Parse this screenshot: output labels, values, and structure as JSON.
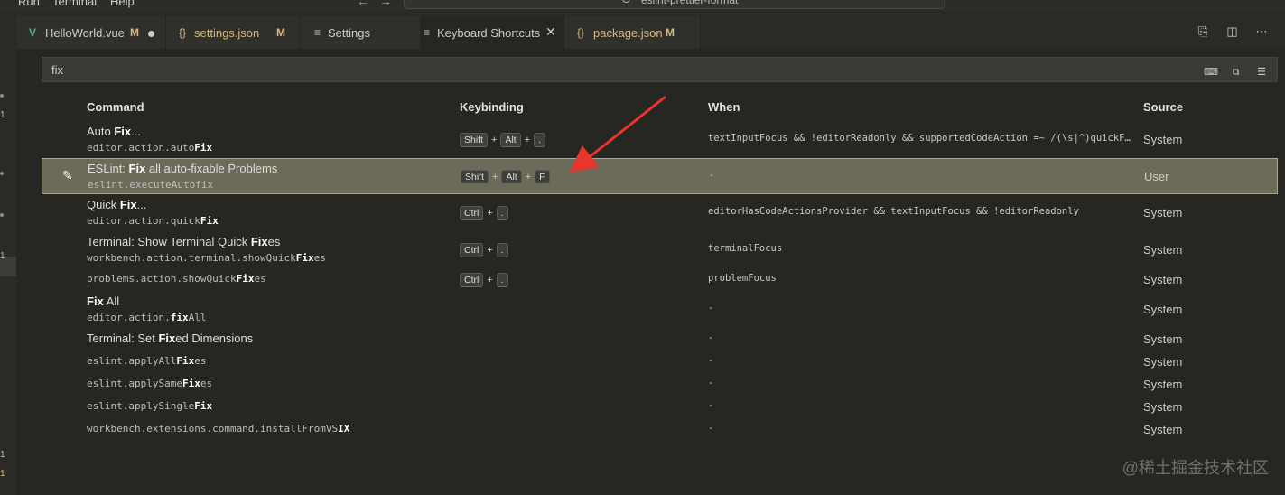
{
  "menu": {
    "run": "Run",
    "terminal": "Terminal",
    "help": "Help"
  },
  "command_center": {
    "label": "eslint-prettier-format",
    "icon": "search-icon"
  },
  "tabs": [
    {
      "icon": "V",
      "label": "HelloWorld.vue",
      "modified": "M",
      "color": "#41b883"
    },
    {
      "icon": "{}",
      "label": "settings.json",
      "modified": "M",
      "color": "#d7ba7d"
    },
    {
      "icon": "≡",
      "label": "Settings",
      "modified": ""
    },
    {
      "icon": "≡",
      "label": "Keyboard Shortcuts",
      "modified": "",
      "active": true
    },
    {
      "icon": "{}",
      "label": "package.json",
      "modified": "M",
      "color": "#d7ba7d"
    }
  ],
  "search": {
    "value": "fix"
  },
  "table": {
    "headers": {
      "command": "Command",
      "keybinding": "Keybinding",
      "when": "When",
      "source": "Source"
    },
    "rows": [
      {
        "title": [
          [
            "Auto ",
            false
          ],
          [
            "Fix",
            true
          ],
          [
            "...",
            false
          ]
        ],
        "id": [
          [
            "editor.action.auto",
            false
          ],
          [
            "Fix",
            true
          ]
        ],
        "keys": [
          "Shift",
          "Alt",
          "."
        ],
        "when": "textInputFocus && !editorReadonly && supportedCodeAction =~ /(\\s|^)quickFix\\b/",
        "source": "System"
      },
      {
        "title": [
          [
            "ESLint: ",
            false
          ],
          [
            "Fix",
            true
          ],
          [
            " all auto-fixable Problems",
            false
          ]
        ],
        "id": [
          [
            "eslint.executeAutofix",
            false
          ]
        ],
        "keys": [
          "Shift",
          "Alt",
          "F"
        ],
        "when": "-",
        "source": "User",
        "selected": true
      },
      {
        "title": [
          [
            "Quick ",
            false
          ],
          [
            "Fix",
            true
          ],
          [
            "...",
            false
          ]
        ],
        "id": [
          [
            "editor.action.quick",
            false
          ],
          [
            "Fix",
            true
          ]
        ],
        "keys": [
          "Ctrl",
          "."
        ],
        "when": "editorHasCodeActionsProvider && textInputFocus && !editorReadonly",
        "source": "System"
      },
      {
        "title": [
          [
            "Terminal: Show Terminal Quick ",
            false
          ],
          [
            "Fix",
            true
          ],
          [
            "es",
            false
          ]
        ],
        "id": [
          [
            "workbench.action.terminal.showQuick",
            false
          ],
          [
            "Fix",
            true
          ],
          [
            "es",
            false
          ]
        ],
        "keys": [
          "Ctrl",
          "."
        ],
        "when": "terminalFocus",
        "source": "System"
      },
      {
        "title": [],
        "id": [
          [
            "problems.action.showQuick",
            false
          ],
          [
            "Fix",
            true
          ],
          [
            "es",
            false
          ]
        ],
        "keys": [
          "Ctrl",
          "."
        ],
        "when": "problemFocus",
        "source": "System"
      },
      {
        "title": [
          [
            "Fix",
            true
          ],
          [
            " All",
            false
          ]
        ],
        "id": [
          [
            "editor.action.",
            false
          ],
          [
            "fix",
            true
          ],
          [
            "All",
            false
          ]
        ],
        "keys": [],
        "when": "-",
        "source": "System"
      },
      {
        "title": [
          [
            "Terminal: Set ",
            false
          ],
          [
            "Fix",
            true
          ],
          [
            "ed Dimensions",
            false
          ]
        ],
        "id": [],
        "keys": [],
        "when": "-",
        "source": "System"
      },
      {
        "title": [],
        "id": [
          [
            "eslint.applyAll",
            false
          ],
          [
            "Fix",
            true
          ],
          [
            "es",
            false
          ]
        ],
        "keys": [],
        "when": "-",
        "source": "System"
      },
      {
        "title": [],
        "id": [
          [
            "eslint.applySame",
            false
          ],
          [
            "Fix",
            true
          ],
          [
            "es",
            false
          ]
        ],
        "keys": [],
        "when": "-",
        "source": "System"
      },
      {
        "title": [],
        "id": [
          [
            "eslint.applySingle",
            false
          ],
          [
            "Fix",
            true
          ]
        ],
        "keys": [],
        "when": "-",
        "source": "System"
      },
      {
        "title": [],
        "id": [
          [
            "workbench.extensions.command.install",
            false
          ],
          [
            "Fr",
            false
          ],
          [
            "omVS",
            false
          ],
          [
            "IX",
            true
          ]
        ],
        "keys": [],
        "when": "-",
        "source": "System"
      }
    ]
  },
  "watermark": "@稀土掘金技术社区",
  "colors": {
    "selection_row": "#6c6a58",
    "annotation_arrow": "#e8362d",
    "modified": "#d7ba7d"
  }
}
